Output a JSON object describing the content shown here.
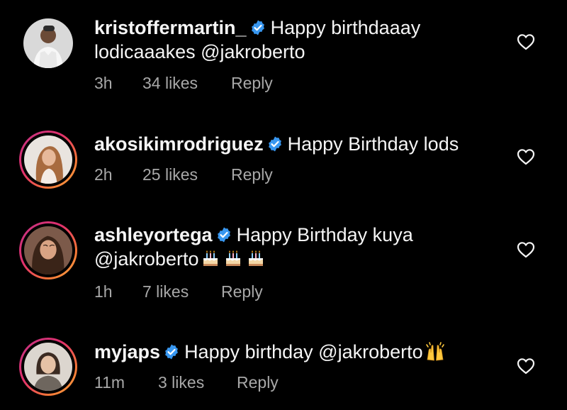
{
  "comments": [
    {
      "username": "kristoffermartin_",
      "text": "Happy birthdaaay lodicaaakes @jakroberto",
      "time": "3h",
      "likes": "34 likes",
      "reply": "Reply",
      "verified": true,
      "story_ring": false
    },
    {
      "username": "akosikimrodriguez",
      "text": "Happy Birthday lods",
      "time": "2h",
      "likes": "25 likes",
      "reply": "Reply",
      "verified": true,
      "story_ring": true
    },
    {
      "username": "ashleyortega",
      "text": "Happy Birthday kuya @jakroberto",
      "emoji": [
        "birthday-cake",
        "birthday-cake",
        "birthday-cake"
      ],
      "time": "1h",
      "likes": "7 likes",
      "reply": "Reply",
      "verified": true,
      "story_ring": true
    },
    {
      "username": "myjaps",
      "text": "Happy birthday @jakroberto",
      "emoji": [
        "raising-hands"
      ],
      "time": "11m",
      "likes": "3 likes",
      "reply": "Reply",
      "verified": true,
      "story_ring": true
    }
  ],
  "colors": {
    "background": "#000000",
    "text": "#f5f5f5",
    "meta": "#a8a8a8",
    "verified": "#3897f0",
    "story_ring": [
      "#c13584",
      "#e1306c",
      "#f77737",
      "#fcaf45"
    ]
  },
  "icons": {
    "like": "heart-outline-icon",
    "verified": "verified-badge-icon"
  }
}
